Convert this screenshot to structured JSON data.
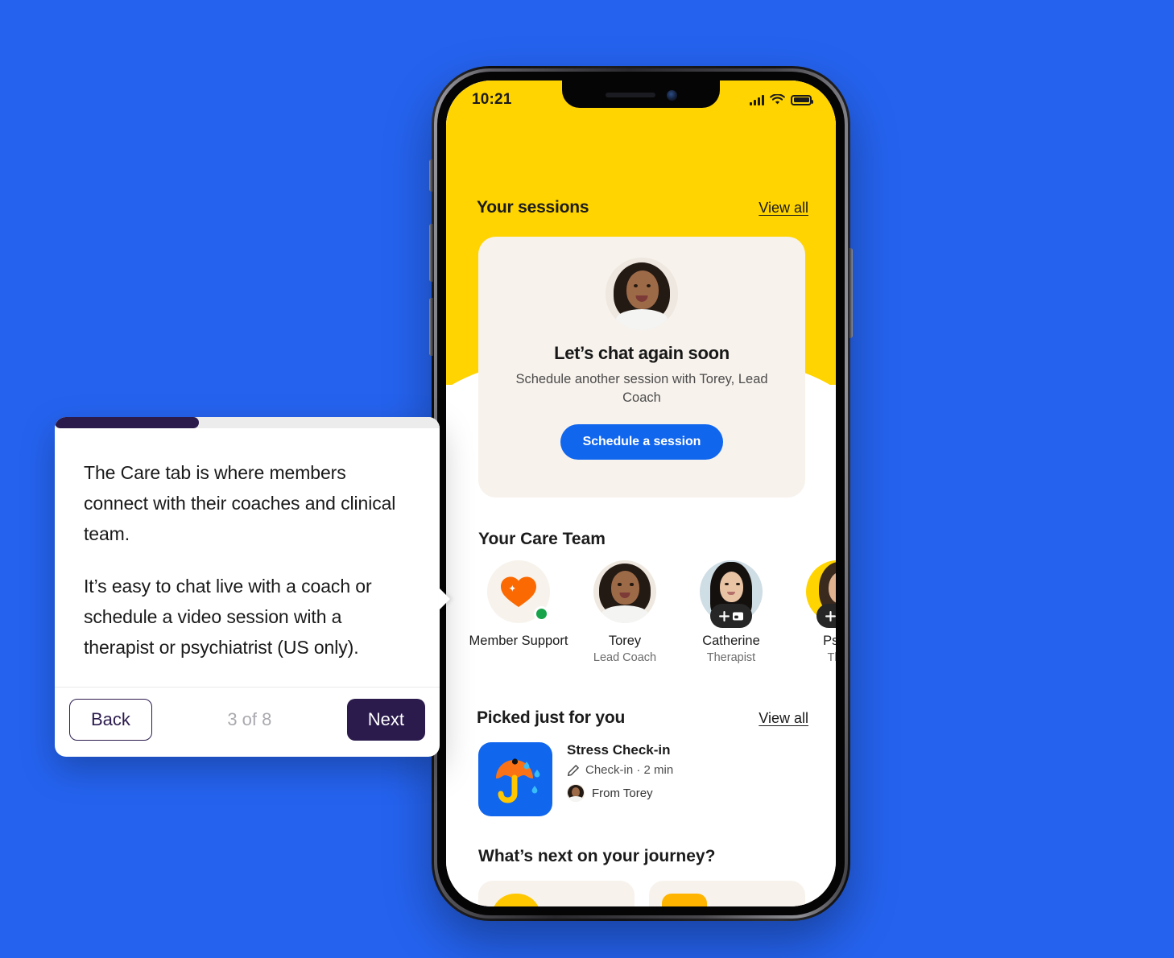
{
  "background_color": "#2563EF",
  "tooltip": {
    "progress_step": 3,
    "progress_total": 8,
    "progress_percent": 37.5,
    "progress_color": "#2B1B4D",
    "paragraph_1": "The Care tab is where members connect with their coaches and clinical team.",
    "paragraph_2": "It’s easy to chat live with a coach or schedule a video session with a therapist or psychiatrist (US only).",
    "back_label": "Back",
    "counter_label": "3 of 8",
    "next_label": "Next"
  },
  "phone": {
    "status_bar": {
      "time": "10:21",
      "signal_icon": "cellular-bars-icon",
      "wifi_icon": "wifi-icon",
      "battery_icon": "battery-full-icon"
    },
    "app": {
      "hero_color": "#FFD400",
      "accent_blue": "#1166EE",
      "card_cream": "#F7F2EC",
      "sessions": {
        "title": "Your sessions",
        "view_all": "View all",
        "card": {
          "avatar": "coach-torey-avatar",
          "title": "Let’s chat again soon",
          "subtitle": "Schedule another session with Torey, Lead Coach",
          "cta_label": "Schedule a session"
        }
      },
      "care_team": {
        "title": "Your Care Team",
        "members": [
          {
            "name": "Member Support",
            "role": "",
            "avatar": "heart-sparkle-icon",
            "status": "online",
            "badge": ""
          },
          {
            "name": "Torey",
            "role": "Lead Coach",
            "avatar": "torey-photo",
            "status": "",
            "badge": ""
          },
          {
            "name": "Catherine",
            "role": "Therapist",
            "avatar": "catherine-photo",
            "status": "",
            "badge": "schedule-badge"
          },
          {
            "name": "Psyc",
            "role": "The",
            "avatar": "psychiatrist-photo",
            "status": "",
            "badge": "schedule-badge"
          }
        ]
      },
      "picked": {
        "title": "Picked just for you",
        "view_all": "View all",
        "item": {
          "thumb_icon": "umbrella-rain-icon",
          "title": "Stress Check-in",
          "meta_icon": "pencil-icon",
          "meta": "Check-in · 2 min",
          "from_avatar": "torey-mini-avatar",
          "from": "From Torey"
        }
      },
      "journey": {
        "title": "What’s next on your journey?",
        "cards": [
          {
            "shape": "yellow-arch-shape"
          },
          {
            "shape": "yellow-square-shape"
          }
        ]
      }
    }
  }
}
